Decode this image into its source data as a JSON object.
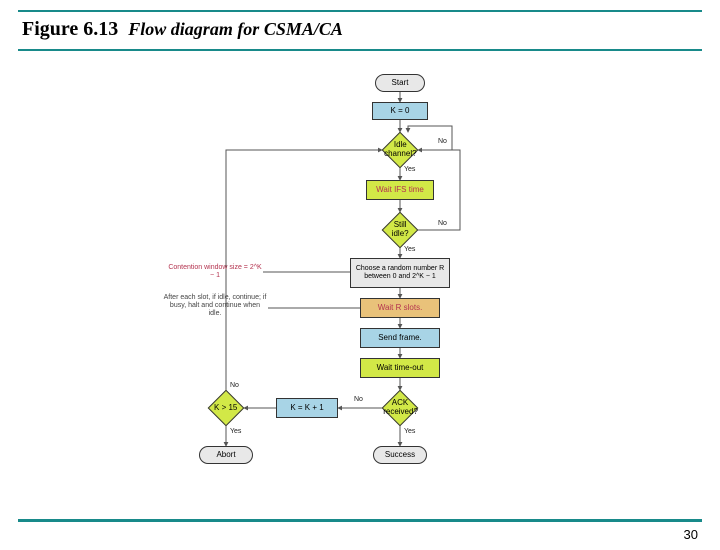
{
  "header": {
    "fig_number": "Figure 6.13",
    "fig_title": "Flow diagram for CSMA/CA"
  },
  "footer": {
    "page_number": "30"
  },
  "nodes": {
    "start": "Start",
    "k0": "K = 0",
    "idle": "Idle channel?",
    "wait_ifs": "Wait IFS time",
    "still_idle": "Still idle?",
    "choose_r": "Choose a random number R between 0 and 2^K − 1",
    "wait_r": "Wait R slots.",
    "send": "Send frame.",
    "wait_to": "Wait time-out",
    "ack": "ACK received?",
    "k_inc": "K = K + 1",
    "k_gt15": "K > 15",
    "abort": "Abort",
    "success": "Success"
  },
  "edges": {
    "yes1": "Yes",
    "no1": "No",
    "yes2": "Yes",
    "no2": "No",
    "no_ack": "No",
    "yes_ack": "Yes",
    "no_k": "No",
    "yes_k": "Yes"
  },
  "notes": {
    "cw_size": "Contention window size = 2^K − 1",
    "slot_rule": "After each slot, if idle, continue; if busy, halt and continue when idle."
  },
  "chart_data": {
    "type": "flowchart",
    "title": "CSMA/CA",
    "nodes": [
      {
        "id": "start",
        "kind": "terminator",
        "label": "Start"
      },
      {
        "id": "k0",
        "kind": "process",
        "label": "K = 0"
      },
      {
        "id": "idle",
        "kind": "decision",
        "label": "Idle channel?"
      },
      {
        "id": "wait_ifs",
        "kind": "process",
        "label": "Wait IFS time"
      },
      {
        "id": "still_idle",
        "kind": "decision",
        "label": "Still idle?"
      },
      {
        "id": "choose_r",
        "kind": "process",
        "label": "Choose a random number R between 0 and 2^K − 1"
      },
      {
        "id": "wait_r",
        "kind": "process",
        "label": "Wait R slots."
      },
      {
        "id": "send",
        "kind": "process",
        "label": "Send frame."
      },
      {
        "id": "wait_to",
        "kind": "process",
        "label": "Wait time-out"
      },
      {
        "id": "ack",
        "kind": "decision",
        "label": "ACK received?"
      },
      {
        "id": "success",
        "kind": "terminator",
        "label": "Success"
      },
      {
        "id": "k_inc",
        "kind": "process",
        "label": "K = K + 1"
      },
      {
        "id": "k_gt15",
        "kind": "decision",
        "label": "K > 15"
      },
      {
        "id": "abort",
        "kind": "terminator",
        "label": "Abort"
      }
    ],
    "edges": [
      {
        "from": "start",
        "to": "k0"
      },
      {
        "from": "k0",
        "to": "idle"
      },
      {
        "from": "idle",
        "to": "wait_ifs",
        "label": "Yes"
      },
      {
        "from": "idle",
        "to": "idle",
        "label": "No",
        "loop": true
      },
      {
        "from": "wait_ifs",
        "to": "still_idle"
      },
      {
        "from": "still_idle",
        "to": "choose_r",
        "label": "Yes"
      },
      {
        "from": "still_idle",
        "to": "idle",
        "label": "No"
      },
      {
        "from": "choose_r",
        "to": "wait_r"
      },
      {
        "from": "wait_r",
        "to": "send"
      },
      {
        "from": "send",
        "to": "wait_to"
      },
      {
        "from": "wait_to",
        "to": "ack"
      },
      {
        "from": "ack",
        "to": "success",
        "label": "Yes"
      },
      {
        "from": "ack",
        "to": "k_inc",
        "label": "No"
      },
      {
        "from": "k_inc",
        "to": "k_gt15"
      },
      {
        "from": "k_gt15",
        "to": "idle",
        "label": "No"
      },
      {
        "from": "k_gt15",
        "to": "abort",
        "label": "Yes"
      }
    ],
    "annotations": [
      {
        "attached_to": "choose_r",
        "text": "Contention window size = 2^K − 1"
      },
      {
        "attached_to": "wait_r",
        "text": "After each slot, if idle, continue; if busy, halt and continue when idle."
      }
    ]
  }
}
